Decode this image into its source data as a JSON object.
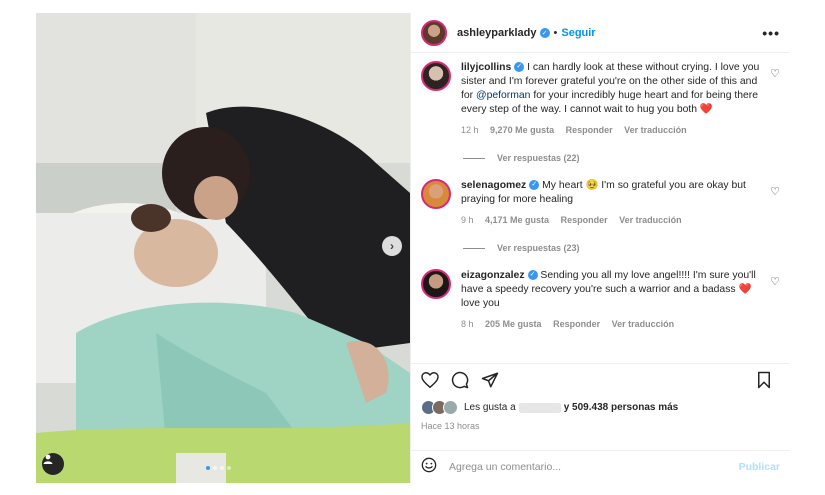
{
  "post": {
    "username": "ashleyparklady",
    "separator": "•",
    "follow_label": "Seguir",
    "more_icon": "more-icon"
  },
  "comments": [
    {
      "username": "lilyjcollins",
      "text_before": "I can hardly look at these without crying. I love you sister and I'm forever grateful you're on the other side of this and for ",
      "mention": "@peforman",
      "text_after": " for your incredibly huge heart and for being there every step of the way. I cannot wait to hug you both ❤️",
      "time": "12 h",
      "likes": "9,270 Me gusta",
      "reply": "Responder",
      "translate": "Ver traducción",
      "replies": "Ver respuestas (22)"
    },
    {
      "username": "selenagomez",
      "text_before": "My heart 🥹 I'm so grateful you are okay but praying for more healing",
      "mention": "",
      "text_after": "",
      "time": "9 h",
      "likes": "4,171 Me gusta",
      "reply": "Responder",
      "translate": "Ver traducción",
      "replies": "Ver respuestas (23)"
    },
    {
      "username": "eizagonzalez",
      "text_before": "Sending you all my love angel!!!! I'm sure you'll have a speedy recovery you're such a warrior and a badass ❤️love you",
      "mention": "",
      "text_after": "",
      "time": "8 h",
      "likes": "205 Me gusta",
      "reply": "Responder",
      "translate": "Ver traducción",
      "replies": ""
    }
  ],
  "engagement": {
    "likes_prefix": "Les gusta a",
    "likes_suffix": "y 509.438 personas más",
    "time_ago": "Hace 13 horas"
  },
  "composer": {
    "placeholder": "Agrega un comentario...",
    "publish_label": "Publicar"
  },
  "colors": {
    "accent": "#0095f6",
    "verified": "#3897f0",
    "muted": "#8e8e8e"
  }
}
